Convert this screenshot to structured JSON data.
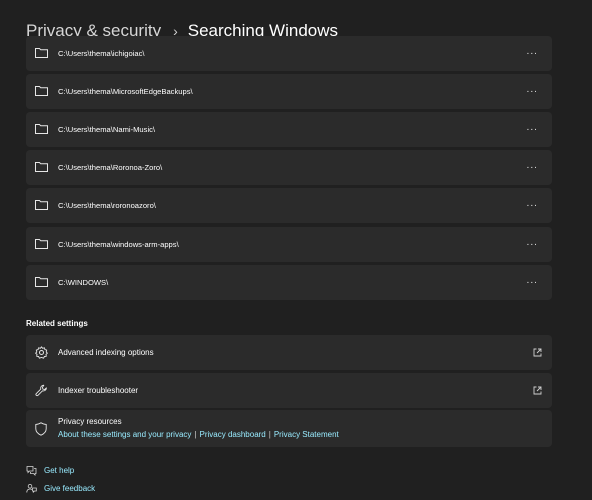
{
  "header": {
    "parent": "Privacy & security",
    "separator": "›",
    "current": "Searching Windows"
  },
  "folders": [
    {
      "path": "C:\\Users\\thema\\ichigoiac\\",
      "more": "···"
    },
    {
      "path": "C:\\Users\\thema\\MicrosoftEdgeBackups\\",
      "more": "···"
    },
    {
      "path": "C:\\Users\\thema\\Nami-Music\\",
      "more": "···"
    },
    {
      "path": "C:\\Users\\thema\\Roronoa-Zoro\\",
      "more": "···"
    },
    {
      "path": "C:\\Users\\thema\\roronoazoro\\",
      "more": "···"
    },
    {
      "path": "C:\\Users\\thema\\windows-arm-apps\\",
      "more": "···"
    },
    {
      "path": "C:\\WINDOWS\\",
      "more": "···"
    }
  ],
  "related": {
    "heading": "Related settings",
    "items": [
      {
        "label": "Advanced indexing options",
        "icon": "gear-icon"
      },
      {
        "label": "Indexer troubleshooter",
        "icon": "wrench-icon"
      }
    ],
    "privacy": {
      "title": "Privacy resources",
      "links": [
        "About these settings and your privacy",
        "Privacy dashboard",
        "Privacy Statement"
      ],
      "separator": "|"
    }
  },
  "footer": {
    "get_help": "Get help",
    "give_feedback": "Give feedback"
  },
  "colors": {
    "background": "#202020",
    "card": "#2b2b2b",
    "link": "#99ebff"
  }
}
